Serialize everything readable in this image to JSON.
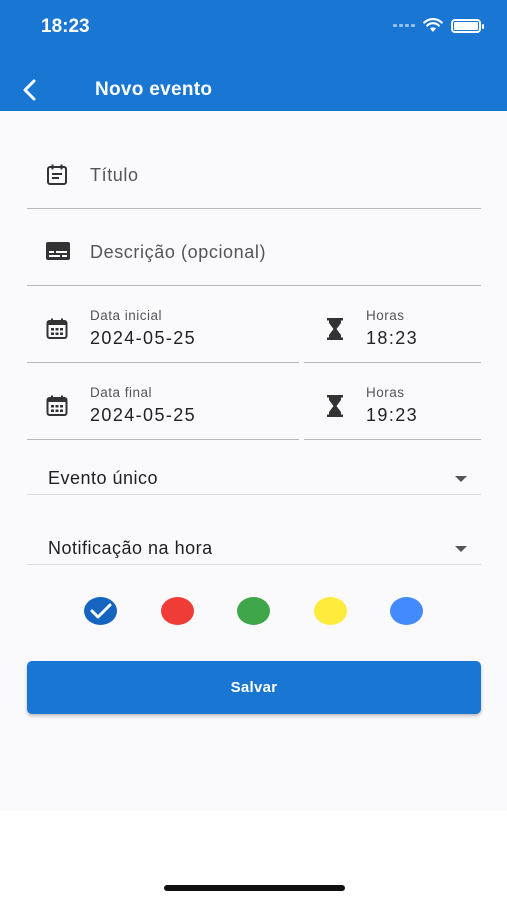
{
  "status_bar": {
    "time": "18:23"
  },
  "app_bar": {
    "title": "Novo evento",
    "back_icon": "chevron-left-icon"
  },
  "form": {
    "title_placeholder": "Título",
    "description_placeholder": "Descrição (opcional)",
    "start_date": {
      "label": "Data inicial",
      "value": "2024-05-25"
    },
    "start_time": {
      "label": "Horas",
      "value": "18:23"
    },
    "end_date": {
      "label": "Data final",
      "value": "2024-05-25"
    },
    "end_time": {
      "label": "Horas",
      "value": "19:23"
    },
    "recurrence": {
      "value": "Evento único"
    },
    "notification": {
      "value": "Notificação na hora"
    }
  },
  "color_options": [
    {
      "name": "blue-dark",
      "color": "#1565C0",
      "selected": true
    },
    {
      "name": "red",
      "color": "#F03C36"
    },
    {
      "name": "green",
      "color": "#3FA74A"
    },
    {
      "name": "yellow",
      "color": "#FFEB3B"
    },
    {
      "name": "blue-light",
      "color": "#448AFF"
    }
  ],
  "save_button": {
    "label": "Salvar"
  },
  "theme": {
    "primary": "#1976D2"
  }
}
